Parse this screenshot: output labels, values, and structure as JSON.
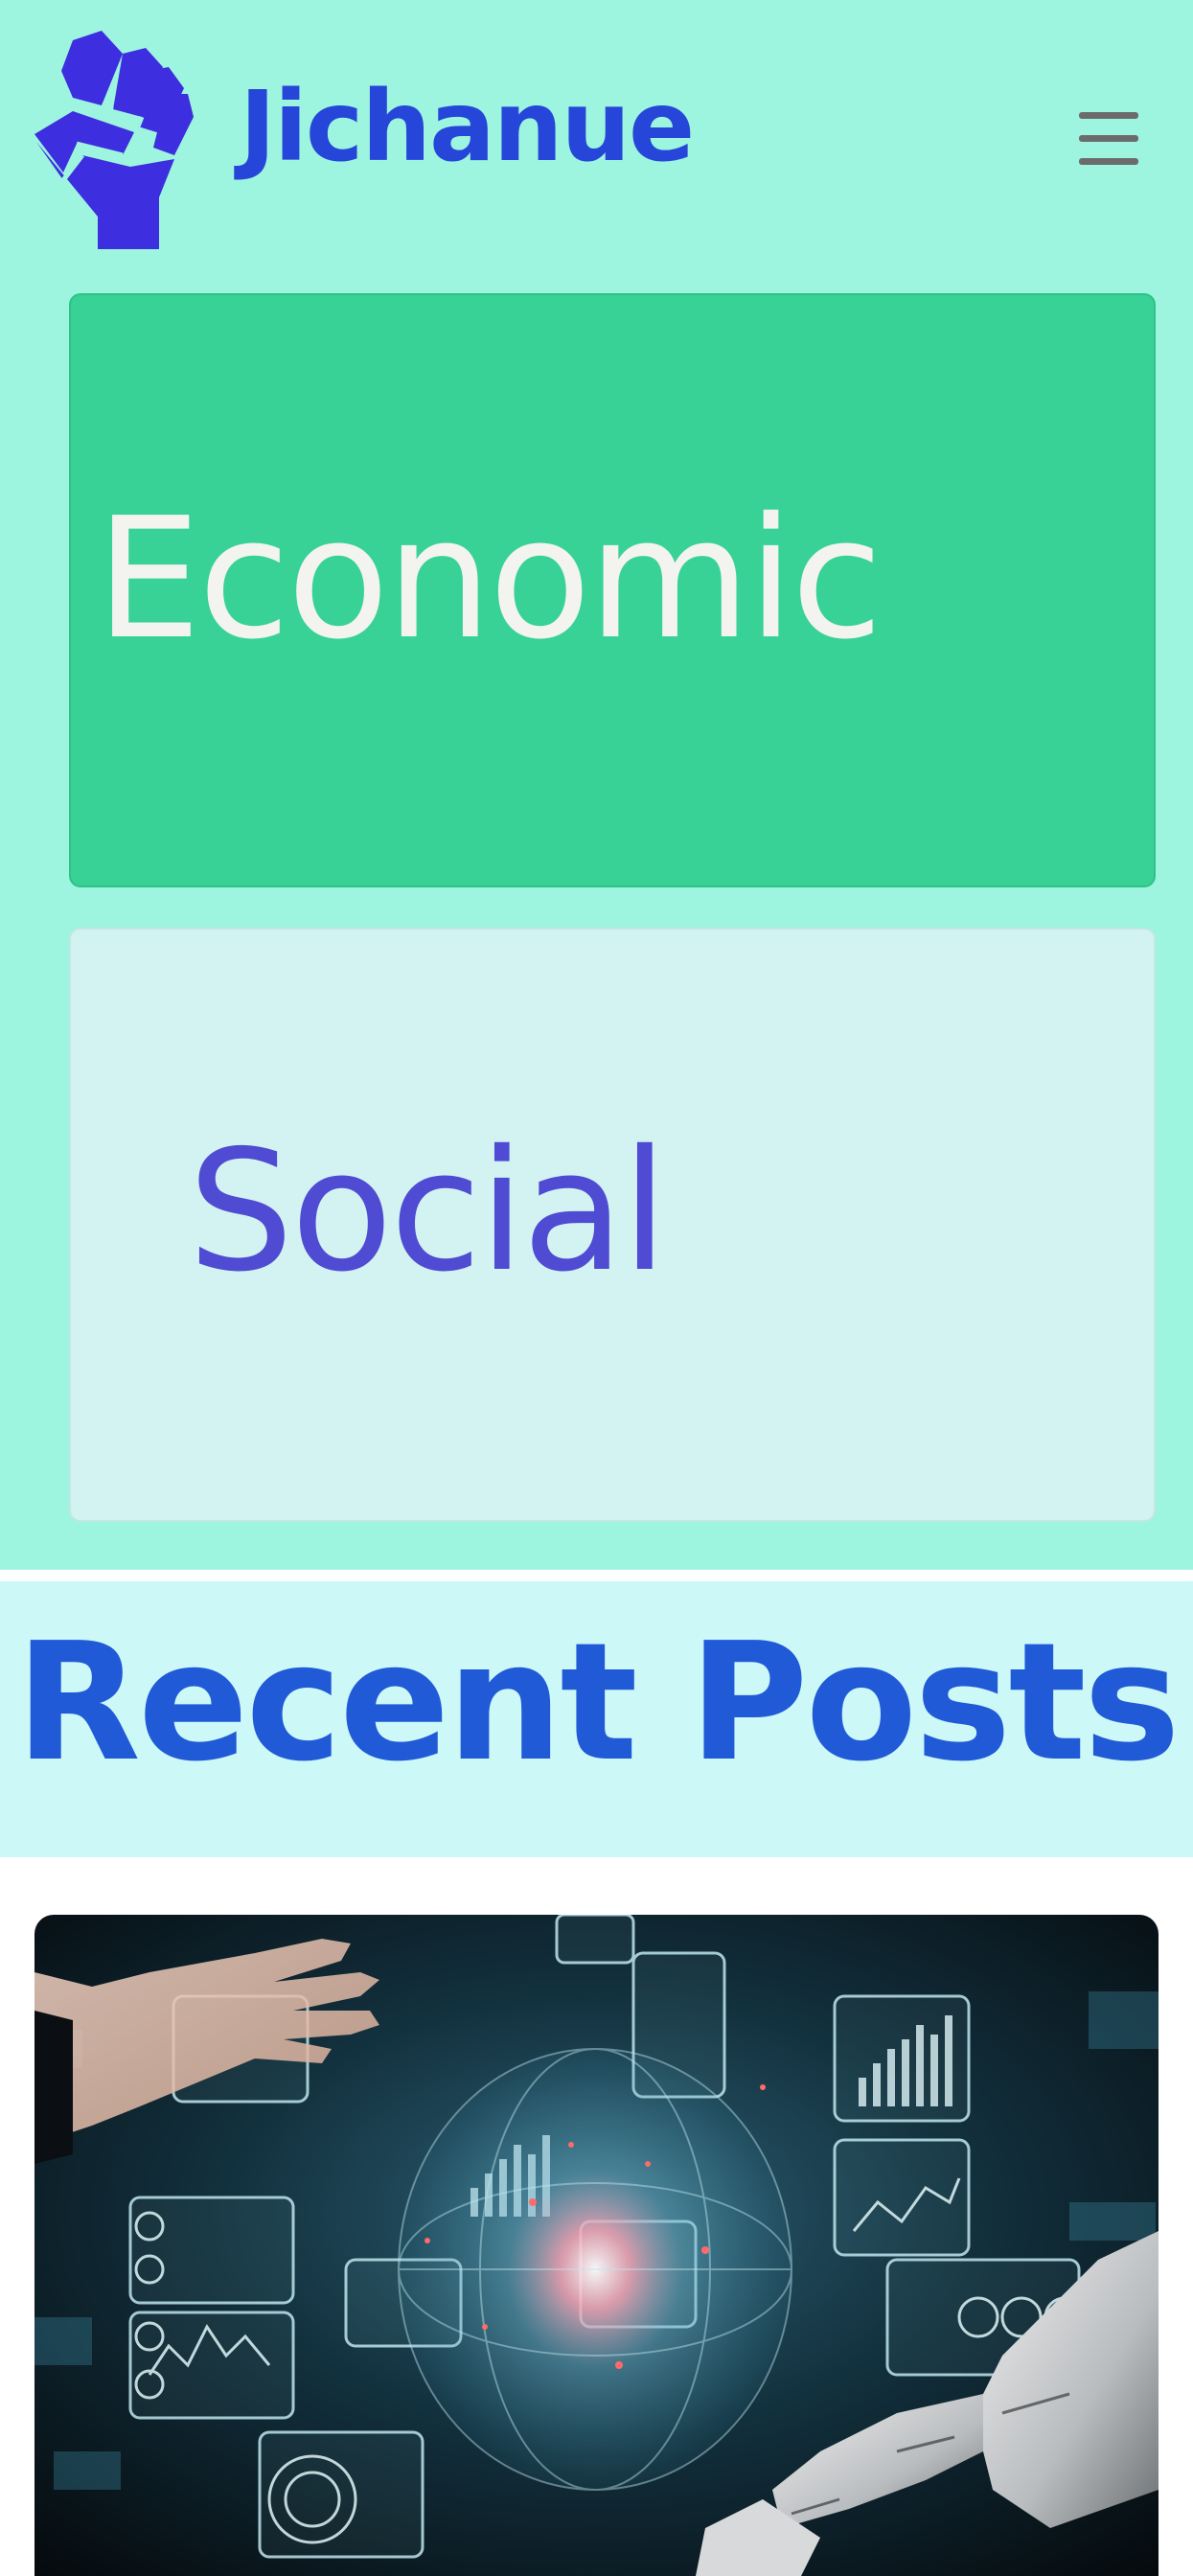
{
  "header": {
    "brand": "Jichanue",
    "logo_icon": "raised-fist-icon",
    "menu_icon": "hamburger-menu-icon"
  },
  "categories": [
    {
      "label": "Economic",
      "background": "#38d296",
      "text_color": "#f3f3ef"
    },
    {
      "label": "Social",
      "background": "#d3f3f3",
      "text_color": "#4f4bd2"
    }
  ],
  "recent": {
    "title": "Recent Posts"
  },
  "posts": [
    {
      "image": "ai-hand-robot-hologram-image"
    }
  ],
  "colors": {
    "top_background": "#9df5df",
    "brand": "#2546d8",
    "recent_background": "#cdf8f8",
    "recent_title": "#215ad7"
  }
}
